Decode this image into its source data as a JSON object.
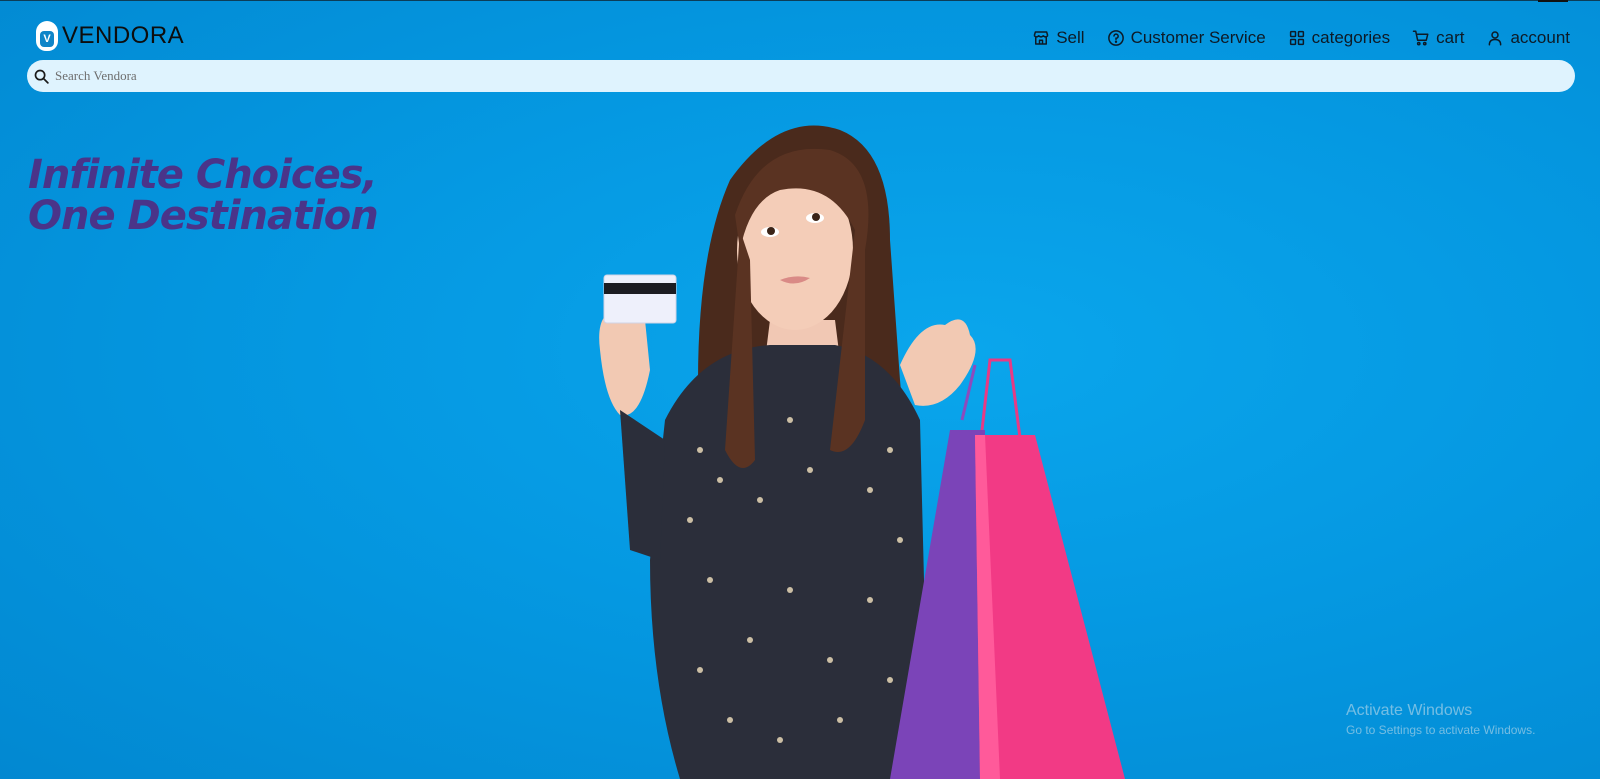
{
  "brand": {
    "name": "VENDORA",
    "logo_letter": "V"
  },
  "nav": [
    {
      "label": "Sell",
      "icon": "store-icon"
    },
    {
      "label": "Customer Service",
      "icon": "help-circle-icon"
    },
    {
      "label": "categories",
      "icon": "grid-icon"
    },
    {
      "label": "cart",
      "icon": "cart-icon"
    },
    {
      "label": "account",
      "icon": "user-icon"
    }
  ],
  "search": {
    "placeholder": "Search Vendora",
    "value": ""
  },
  "hero": {
    "headline_line1": "Infinite Choices,",
    "headline_line2": "One Destination"
  },
  "system_watermark": {
    "title": "Activate Windows",
    "subtitle": "Go to Settings to activate Windows."
  },
  "colors": {
    "background": "#0197df",
    "headline": "#4a3489",
    "search_bg": "#dff3fe",
    "text": "#0d1a26"
  }
}
